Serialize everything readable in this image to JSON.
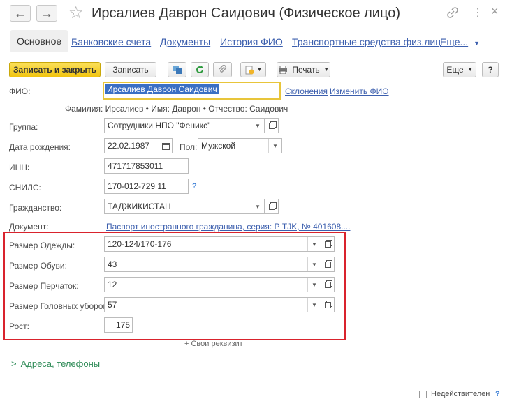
{
  "window": {
    "title": "Ирсалиев Даврон Саидович (Физическое лицо)",
    "nav_back": "←",
    "nav_forward": "→",
    "star": "☆",
    "link_icon": "link-icon",
    "more_icon": "⋮",
    "close": "×"
  },
  "tabs": [
    {
      "label": "Основное"
    },
    {
      "label": "Банковские счета"
    },
    {
      "label": "Документы"
    },
    {
      "label": "История ФИО"
    },
    {
      "label": "Транспортные средства физ.лиц"
    },
    {
      "label": "Еще..."
    }
  ],
  "toolbar": {
    "save_close": "Записать и закрыть",
    "save": "Записать",
    "print": "Печать",
    "more": "Еще",
    "help": "?"
  },
  "form": {
    "fio_label": "ФИО:",
    "fio_value": "Ирсалиев Даврон Саидович",
    "declensions_link": "Склонения",
    "change_fio_link": "Изменить ФИО",
    "name_parts": "Фамилия: Ирсалиев • Имя: Даврон • Отчество: Саидович",
    "group_label": "Группа:",
    "group_value": "Сотрудники НПО \"Феникс\"",
    "birth_label": "Дата рождения:",
    "birth_value": "22.02.1987",
    "sex_label": "Пол:",
    "sex_value": "Мужской",
    "inn_label": "ИНН:",
    "inn_value": "471717853011",
    "snils_label": "СНИЛС:",
    "snils_value": "170-012-729 11",
    "snils_help": "?",
    "citizenship_label": "Гражданство:",
    "citizenship_value": "ТАДЖИКИСТАН",
    "document_label": "Документ:",
    "document_value": "Паспорт иностранного гражданина, серия: Р TJK, № 401608....",
    "clothes_label": "Размер Одежды:",
    "clothes_value": "120-124/170-176",
    "shoes_label": "Размер Обуви:",
    "shoes_value": "43",
    "gloves_label": "Размер Перчаток:",
    "gloves_value": "12",
    "hat_label": "Размер Головных уборов:",
    "hat_value": "57",
    "height_label": "Рост:",
    "height_value": "175",
    "own_attr": "+ Свои реквизит",
    "addresses": "Адреса, телефоны",
    "inactive_label": "Недействителен",
    "inactive_help": "?"
  },
  "colors": {
    "highlight_border": "#d9232d",
    "focus_border": "#e8c53a",
    "link": "#3c5fae",
    "group_green": "#2e8b57"
  }
}
